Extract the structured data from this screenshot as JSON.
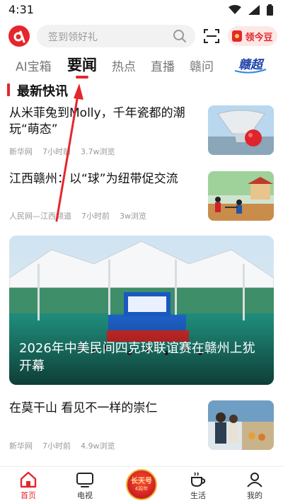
{
  "status_bar": {
    "time": "4:31"
  },
  "header": {
    "search_placeholder": "签到领好礼",
    "coupon_label": "领今豆"
  },
  "tabs": [
    {
      "label": "AI宝箱"
    },
    {
      "label": "要闻"
    },
    {
      "label": "热点"
    },
    {
      "label": "直播"
    },
    {
      "label": "赣问"
    },
    {
      "label": "赣超"
    }
  ],
  "section": {
    "title": "最新快讯"
  },
  "news": [
    {
      "title": "从米菲兔到Molly，千年瓷都的潮玩“萌态”",
      "source": "新华网",
      "time": "7小时前",
      "views": "3.7w浏览"
    },
    {
      "title": "江西赣州：以“球”为纽带促交流",
      "source": "人民网—江西频道",
      "time": "7小时前",
      "views": "3w浏览"
    },
    {
      "title": "在莫干山 看见不一样的崇仁",
      "source": "新华网",
      "time": "7小时前",
      "views": "4.9w浏览"
    }
  ],
  "featured": {
    "title": "2026年中美民间四克球联谊赛在赣州上犹开幕"
  },
  "bottom_nav": {
    "home": "首页",
    "tv": "电视",
    "center_title": "长天号",
    "center_sub": "4周年",
    "life": "生活",
    "me": "我的"
  },
  "colors": {
    "accent": "#e5262c"
  }
}
